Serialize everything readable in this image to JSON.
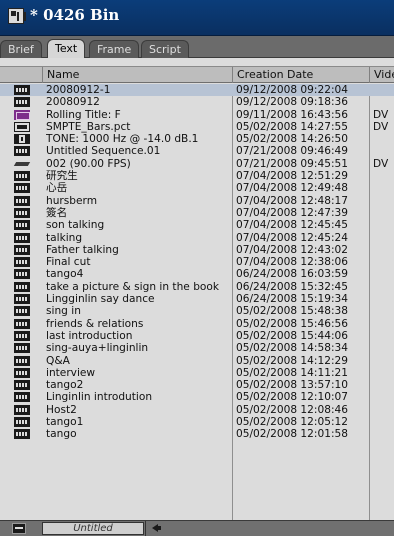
{
  "window": {
    "title": "* 0426 Bin",
    "icon": "bin-window-icon"
  },
  "tabs": [
    {
      "label": "Brief",
      "active": false
    },
    {
      "label": "Text",
      "active": true
    },
    {
      "label": "Frame",
      "active": false
    },
    {
      "label": "Script",
      "active": false
    }
  ],
  "columns": {
    "name": "Name",
    "creation_date": "Creation Date",
    "video": "Vide"
  },
  "rows": [
    {
      "icon": "bin-clip-icon",
      "name": "20080912-1",
      "date": "09/12/2008 09:22:04",
      "video": "",
      "selected": true
    },
    {
      "icon": "bin-clip-icon",
      "name": "20080912",
      "date": "09/12/2008 09:18:36",
      "video": ""
    },
    {
      "icon": "title-icon",
      "name": "Rolling Title: F",
      "date": "09/11/2008 16:43:56",
      "video": "DV"
    },
    {
      "icon": "graphic-icon",
      "name": "SMPTE_Bars.pct",
      "date": "05/02/2008 14:27:55",
      "video": "DV"
    },
    {
      "icon": "tone-icon",
      "name": "TONE: 1000 Hz @ -14.0 dB.1",
      "date": "05/02/2008 14:26:50",
      "video": ""
    },
    {
      "icon": "bin-clip-icon",
      "name": "Untitled Sequence.01",
      "date": "07/21/2008 09:46:49",
      "video": ""
    },
    {
      "icon": "effect-icon",
      "name": "002 (90.00 FPS)",
      "date": "07/21/2008 09:45:51",
      "video": "DV"
    },
    {
      "icon": "bin-clip-icon",
      "name": "研究生",
      "date": "07/04/2008 12:51:29",
      "video": ""
    },
    {
      "icon": "bin-clip-icon",
      "name": "心岳",
      "date": "07/04/2008 12:49:48",
      "video": ""
    },
    {
      "icon": "bin-clip-icon",
      "name": "hursberm",
      "date": "07/04/2008 12:48:17",
      "video": ""
    },
    {
      "icon": "bin-clip-icon",
      "name": "簽名",
      "date": "07/04/2008 12:47:39",
      "video": ""
    },
    {
      "icon": "bin-clip-icon",
      "name": "son talking",
      "date": "07/04/2008 12:45:45",
      "video": ""
    },
    {
      "icon": "bin-clip-icon",
      "name": "talking",
      "date": "07/04/2008 12:45:24",
      "video": ""
    },
    {
      "icon": "bin-clip-icon",
      "name": "Father talking",
      "date": "07/04/2008 12:43:02",
      "video": ""
    },
    {
      "icon": "bin-clip-icon",
      "name": "Final cut",
      "date": "07/04/2008 12:38:06",
      "video": ""
    },
    {
      "icon": "bin-clip-icon",
      "name": "tango4",
      "date": "06/24/2008 16:03:59",
      "video": ""
    },
    {
      "icon": "bin-clip-icon",
      "name": "take a picture & sign in the book",
      "date": "06/24/2008 15:32:45",
      "video": ""
    },
    {
      "icon": "bin-clip-icon",
      "name": "Lingginlin say dance",
      "date": "06/24/2008 15:19:34",
      "video": ""
    },
    {
      "icon": "bin-clip-icon",
      "name": "sing in",
      "date": "05/02/2008 15:48:38",
      "video": ""
    },
    {
      "icon": "bin-clip-icon",
      "name": "friends & relations",
      "date": "05/02/2008 15:46:56",
      "video": ""
    },
    {
      "icon": "bin-clip-icon",
      "name": "last introduction",
      "date": "05/02/2008 15:44:06",
      "video": ""
    },
    {
      "icon": "bin-clip-icon",
      "name": "sing-auya+linginlin",
      "date": "05/02/2008 14:58:34",
      "video": ""
    },
    {
      "icon": "bin-clip-icon",
      "name": "Q&A",
      "date": "05/02/2008 14:12:29",
      "video": ""
    },
    {
      "icon": "bin-clip-icon",
      "name": "interview",
      "date": "05/02/2008 14:11:21",
      "video": ""
    },
    {
      "icon": "bin-clip-icon",
      "name": "tango2",
      "date": "05/02/2008 13:57:10",
      "video": ""
    },
    {
      "icon": "bin-clip-icon",
      "name": "Linginlin introdution",
      "date": "05/02/2008 12:10:07",
      "video": ""
    },
    {
      "icon": "bin-clip-icon",
      "name": "Host2",
      "date": "05/02/2008 12:08:46",
      "video": ""
    },
    {
      "icon": "bin-clip-icon",
      "name": "tango1",
      "date": "05/02/2008 12:05:12",
      "video": ""
    },
    {
      "icon": "bin-clip-icon",
      "name": "tango",
      "date": "05/02/2008 12:01:58",
      "video": ""
    }
  ],
  "statusbar": {
    "view_name": "Untitled",
    "menu_icon": "bin-menu-icon",
    "arrow_icon": "arrow-left-icon"
  },
  "colors": {
    "titlebar": "#0b3d7a",
    "selection": "#b7c3d4",
    "grid_bg": "#dcdcdc"
  }
}
